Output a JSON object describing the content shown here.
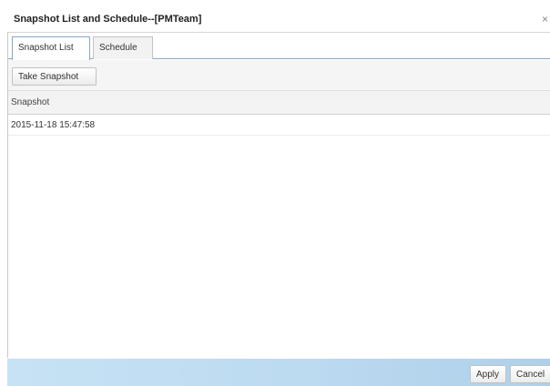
{
  "dialog": {
    "title": "Snapshot List and Schedule--[PMTeam]",
    "close_glyph": "×"
  },
  "tabs": [
    {
      "label": "Snapshot List",
      "active": true
    },
    {
      "label": "Schedule",
      "active": false
    }
  ],
  "toolbar": {
    "take_snapshot_label": "Take Snapshot"
  },
  "grid": {
    "columns": [
      "Snapshot"
    ],
    "rows": [
      {
        "snapshot": "2015-11-18 15:47:58"
      }
    ]
  },
  "footer": {
    "apply_label": "Apply",
    "cancel_label": "Cancel"
  }
}
